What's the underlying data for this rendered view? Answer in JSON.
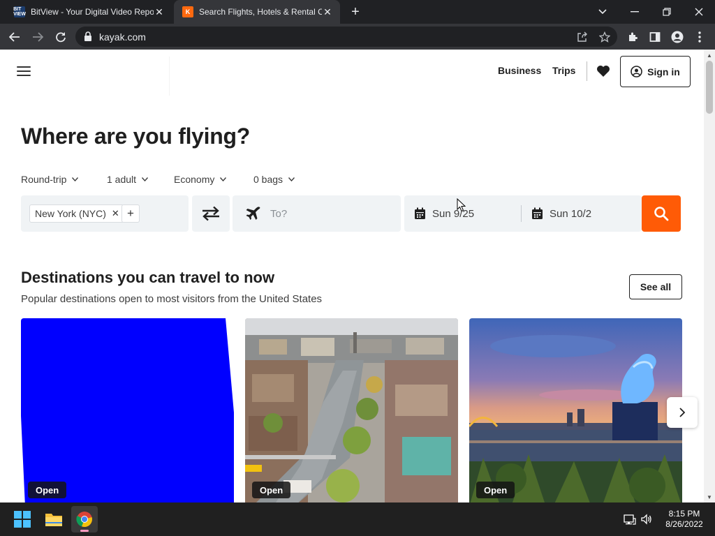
{
  "browser": {
    "tabs": [
      {
        "title": "BitView - Your Digital Video Repository",
        "favicon": "BIT VIEW",
        "active": false
      },
      {
        "title": "Search Flights, Hotels & Rental Cars",
        "favicon": "K",
        "active": true
      }
    ],
    "url": "kayak.com",
    "icons": [
      "back-icon",
      "forward-icon",
      "reload-icon",
      "lock-icon",
      "share-icon",
      "star-icon",
      "extensions-icon",
      "side-panel-icon",
      "profile-icon",
      "menu-icon"
    ]
  },
  "header": {
    "nav": [
      {
        "label": "Business"
      },
      {
        "label": "Trips"
      }
    ],
    "signin_label": "Sign in"
  },
  "search": {
    "headline": "Where are you flying?",
    "options": [
      {
        "label": "Round-trip"
      },
      {
        "label": "1 adult"
      },
      {
        "label": "Economy"
      },
      {
        "label": "0 bags"
      }
    ],
    "origin_chip": "New York (NYC)",
    "destination_placeholder": "To?",
    "depart_date": "Sun 9/25",
    "return_date": "Sun 10/2",
    "search_button_color": "#ff5b06"
  },
  "destinations": {
    "title": "Destinations you can travel to now",
    "subtitle": "Popular destinations open to most visitors from the United States",
    "see_all_label": "See all",
    "cards": [
      {
        "badge": "Open"
      },
      {
        "badge": "Open"
      },
      {
        "badge": "Open"
      }
    ]
  },
  "taskbar": {
    "time": "8:15 PM",
    "date": "8/26/2022"
  }
}
